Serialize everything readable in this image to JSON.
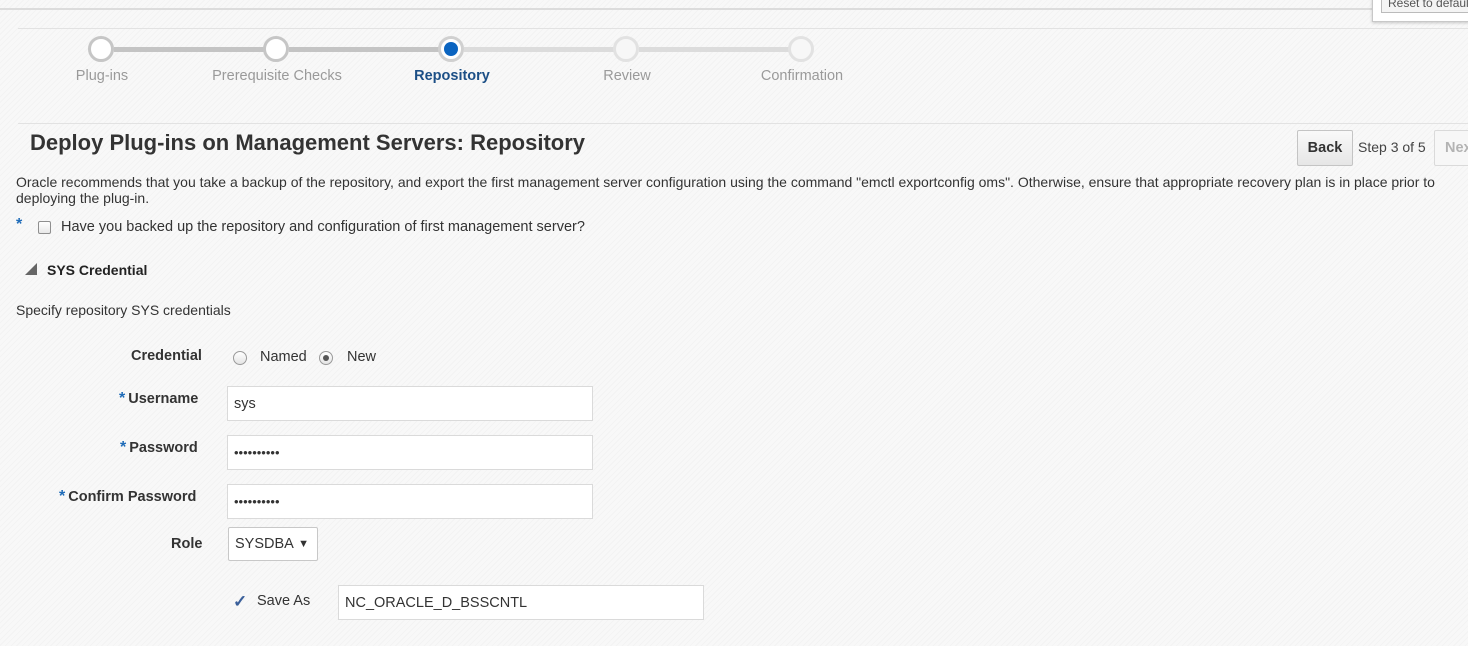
{
  "popup": {
    "reset_label": "Reset to default"
  },
  "train": {
    "steps": [
      {
        "label": "Plug-ins",
        "state": "visited"
      },
      {
        "label": "Prerequisite Checks",
        "state": "visited"
      },
      {
        "label": "Repository",
        "state": "current"
      },
      {
        "label": "Review",
        "state": "future"
      },
      {
        "label": "Confirmation",
        "state": "future"
      }
    ]
  },
  "header": {
    "title": "Deploy Plug-ins on Management Servers: Repository",
    "back_label": "Back",
    "step_text": "Step 3 of 5",
    "next_label": "Next"
  },
  "info_text": "Oracle recommends that you take a backup of the repository, and export the first management server configuration using the command \"emctl exportconfig oms\". Otherwise, ensure that appropriate recovery plan is in place prior to deploying the plug-in.",
  "backup_check": {
    "required_mark": "*",
    "label": "Have you backed up the repository and configuration of first management server?",
    "checked": false
  },
  "section": {
    "title": "SYS Credential",
    "description": "Specify repository SYS credentials"
  },
  "form": {
    "credential_label": "Credential",
    "credential_options": [
      "Named",
      "New"
    ],
    "credential_selected": "New",
    "username_label": "Username",
    "username_value": "sys",
    "password_label": "Password",
    "password_value": "••••••••••",
    "confirm_label": "Confirm Password",
    "confirm_value": "••••••••••",
    "role_label": "Role",
    "role_value": "SYSDBA",
    "save_as_label": "Save As",
    "save_as_checked": true,
    "save_as_value": "NC_ORACLE_D_BSSCNTL",
    "required_mark": "*"
  },
  "colors": {
    "accent": "#0b64c0",
    "required": "#1e6bb8",
    "current_step": "#1c4f86"
  }
}
